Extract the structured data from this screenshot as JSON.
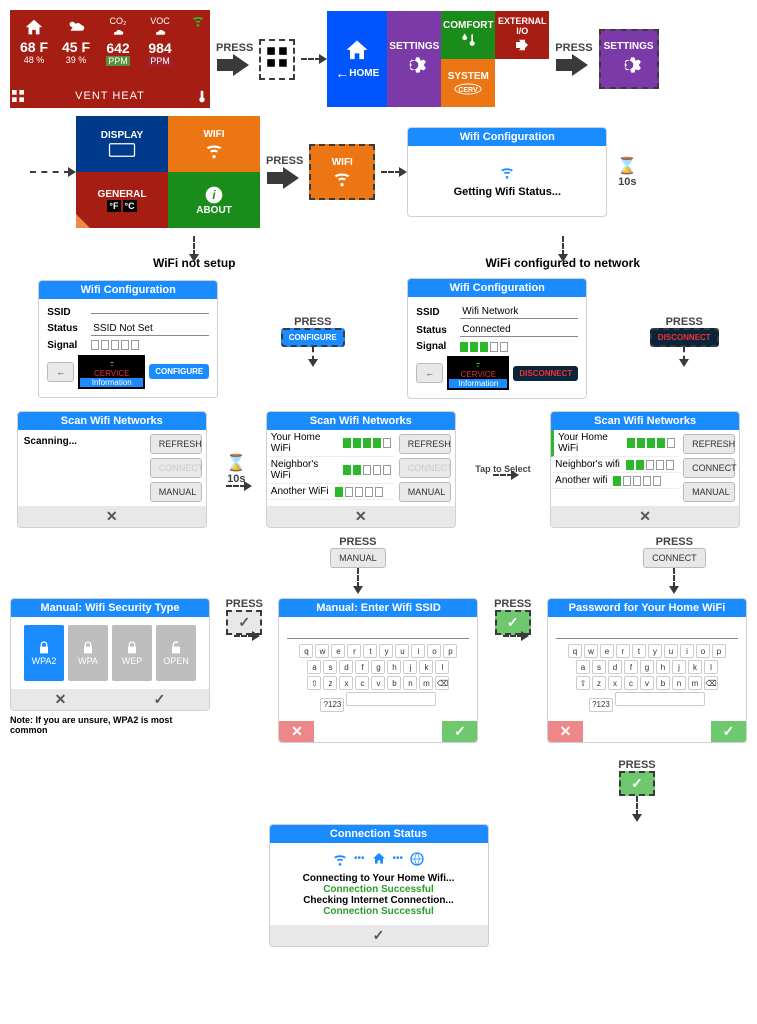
{
  "row1": {
    "home_tiles": {
      "indoor": {
        "value": "68 F",
        "sub": "48 %"
      },
      "outdoor": {
        "value": "45 F",
        "sub": "39 %"
      },
      "co2": {
        "label": "CO₂",
        "value": "642",
        "unit": "PPM"
      },
      "voc": {
        "label": "VOC",
        "value": "984",
        "unit": "PPM"
      },
      "footer": "VENT HEAT"
    },
    "press": "PRESS",
    "menu": {
      "comfort": "COMFORT",
      "ext": "EXTERNAL\nI/O",
      "home": "HOME",
      "system": "SYSTEM",
      "settings": "SETTINGS"
    },
    "settings_tile": "SETTINGS"
  },
  "row2": {
    "tiles": {
      "display": "DISPLAY",
      "wifi": "WIFI",
      "general": "GENERAL",
      "about": "ABOUT"
    },
    "press": "PRESS",
    "wifi_tile": "WIFI",
    "getting_panel": {
      "title": "Wifi Configuration",
      "msg": "Getting Wifi Status..."
    },
    "wait": "10s"
  },
  "branch_labels": {
    "left": "WiFi not setup",
    "right": "WiFi configured to network"
  },
  "cfg_left": {
    "title": "Wifi Configuration",
    "ssid_label": "SSID",
    "ssid_value": "",
    "status_label": "Status",
    "status_value": "SSID Not Set",
    "signal_label": "Signal",
    "cervice": "CERVICE",
    "cervice_sub": "Information",
    "btn_configure": "CONFIGURE",
    "press_btn": "CONFIGURE",
    "press": "PRESS"
  },
  "cfg_right": {
    "title": "Wifi Configuration",
    "ssid_label": "SSID",
    "ssid_value": "Wifi Network",
    "status_label": "Status",
    "status_value": "Connected",
    "signal_label": "Signal",
    "cervice": "CERVICE",
    "cervice_sub": "Information",
    "btn_disconnect": "DISCONNECT",
    "press_btn": "DISCONNECT",
    "press": "PRESS"
  },
  "scan": {
    "title": "Scan Wifi Networks",
    "scanning": "Scanning...",
    "refresh": "REFRESH",
    "connect": "CONNECT",
    "manual": "MANUAL",
    "wait": "10s",
    "tap": "Tap to Select",
    "nets1": [
      "Your Home WiFi",
      "Neighbor's WiFi",
      "Another WiFi"
    ],
    "nets2": [
      "Your Home WiFi",
      "Neighbor's wifi",
      "Another wifi"
    ]
  },
  "press_manual": {
    "press": "PRESS",
    "label": "MANUAL"
  },
  "press_connect": {
    "press": "PRESS",
    "label": "CONNECT"
  },
  "security": {
    "title": "Manual: Wifi Security Type",
    "opts": [
      "WPA2",
      "WPA",
      "WEP",
      "OPEN"
    ],
    "note": "Note: If you are unsure, WPA2 is most common",
    "press": "PRESS"
  },
  "enter_ssid": {
    "title": "Manual: Enter Wifi SSID",
    "press": "PRESS"
  },
  "enter_pwd": {
    "title": "Password for Your Home WiFi"
  },
  "keyboard": {
    "r1": [
      "q",
      "w",
      "e",
      "r",
      "t",
      "y",
      "u",
      "i",
      "o",
      "p"
    ],
    "r2": [
      "a",
      "s",
      "d",
      "f",
      "g",
      "h",
      "j",
      "k",
      "l"
    ],
    "r3": [
      "z",
      "x",
      "c",
      "v",
      "b",
      "n",
      "m"
    ],
    "shift": "⇧",
    "num": "?123",
    "back": "⌫"
  },
  "press_final": "PRESS",
  "status": {
    "title": "Connection Status",
    "l1": "Connecting to Your Home Wifi...",
    "l2": "Connection Successful",
    "l3": "Checking Internet Connection...",
    "l4": "Connection Successful"
  }
}
